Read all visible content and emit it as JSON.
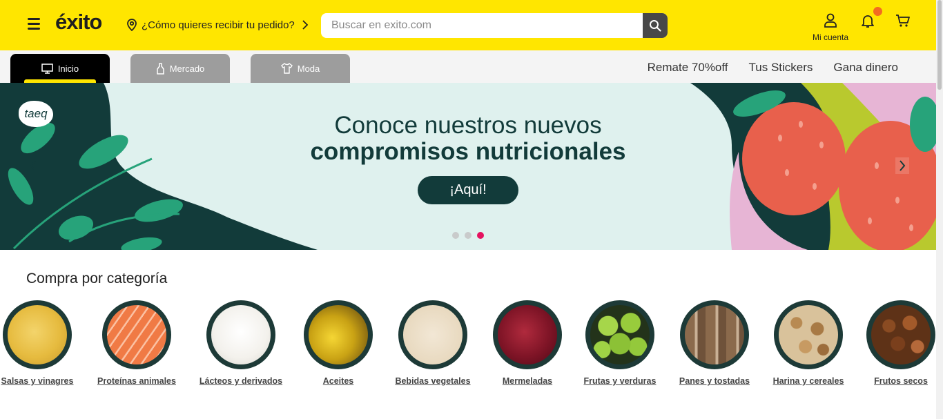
{
  "header": {
    "logo_text": "éxito",
    "location_prompt": "¿Cómo quieres recibir tu pedido?",
    "search_placeholder": "Buscar en exito.com",
    "account_label": "Mi cuenta",
    "brand_color": "#ffe600"
  },
  "nav": {
    "tabs": [
      {
        "label": "Inicio",
        "icon": "monitor-icon",
        "active": true
      },
      {
        "label": "Mercado",
        "icon": "bottle-icon",
        "active": false
      },
      {
        "label": "Moda",
        "icon": "shirt-icon",
        "active": false
      }
    ],
    "links": [
      "Remate 70%off",
      "Tus Stickers",
      "Gana dinero"
    ]
  },
  "banner": {
    "brand": "taeq",
    "title_line1": "Conoce nuestros nuevos",
    "title_line2": "compromisos nutricionales",
    "cta": "¡Aquí!",
    "slides_total": 3,
    "active_slide": 3,
    "accent_color": "#e5125f"
  },
  "categories": {
    "title": "Compra por categoría",
    "items": [
      {
        "label": "Salsas y vinagres"
      },
      {
        "label": "Proteínas animales"
      },
      {
        "label": "Lácteos y derivados"
      },
      {
        "label": "Aceites"
      },
      {
        "label": "Bebidas vegetales"
      },
      {
        "label": "Mermeladas"
      },
      {
        "label": "Frutas y verduras"
      },
      {
        "label": "Panes y tostadas"
      },
      {
        "label": "Harina y cereales"
      },
      {
        "label": "Frutos secos"
      }
    ]
  }
}
